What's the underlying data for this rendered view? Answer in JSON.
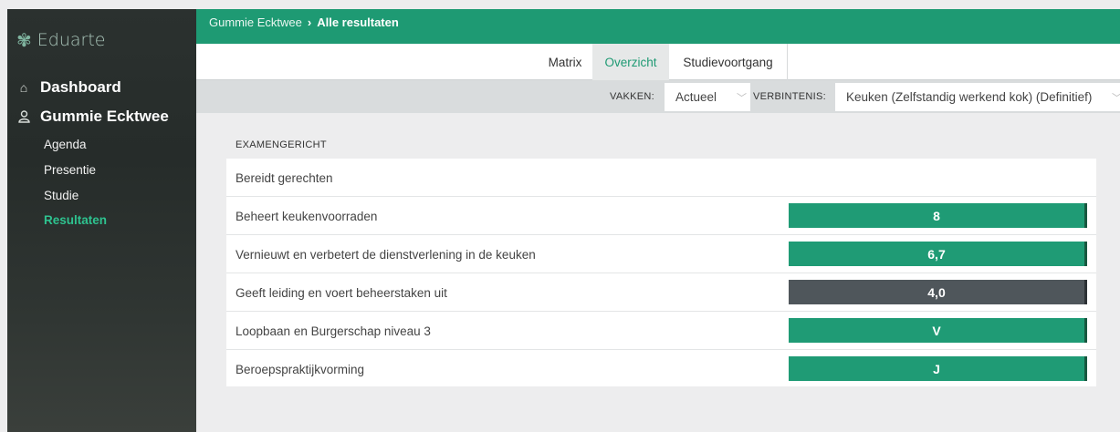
{
  "app": {
    "name": "Eduarte",
    "accent": "#1e9a73",
    "active_nav": "#2ec28f",
    "fail_color": "#4f565b"
  },
  "sidebar": {
    "main": [
      {
        "label": "Dashboard",
        "icon": "home-icon"
      },
      {
        "label": "Gummie Ecktwee",
        "icon": "user-icon"
      }
    ],
    "sub": [
      {
        "label": "Agenda",
        "active": false
      },
      {
        "label": "Presentie",
        "active": false
      },
      {
        "label": "Studie",
        "active": false
      },
      {
        "label": "Resultaten",
        "active": true
      }
    ]
  },
  "breadcrumb": {
    "student": "Gummie Ecktwee",
    "separator": "›",
    "current": "Alle resultaten"
  },
  "tabs": [
    {
      "label": "Matrix",
      "active": false
    },
    {
      "label": "Overzicht",
      "active": true
    },
    {
      "label": "Studievoortgang",
      "active": false
    }
  ],
  "filters": {
    "vakken_label": "VAKKEN:",
    "vakken_value": "Actueel",
    "verbintenis_label": "VERBINTENIS:",
    "verbintenis_value": "Keuken (Zelfstandig werkend kok) (Definitief)"
  },
  "section": {
    "title": "EXAMENGERICHT",
    "rows": [
      {
        "label": "Bereidt gerechten",
        "grade": null,
        "status": null
      },
      {
        "label": "Beheert keukenvoorraden",
        "grade": "8",
        "status": "green"
      },
      {
        "label": "Vernieuwt en verbetert de dienstverlening in de keuken",
        "grade": "6,7",
        "status": "green"
      },
      {
        "label": "Geeft leiding en voert beheerstaken uit",
        "grade": "4,0",
        "status": "gray"
      },
      {
        "label": "Loopbaan en Burgerschap niveau 3",
        "grade": "V",
        "status": "green"
      },
      {
        "label": "Beroepspraktijkvorming",
        "grade": "J",
        "status": "green"
      }
    ]
  }
}
